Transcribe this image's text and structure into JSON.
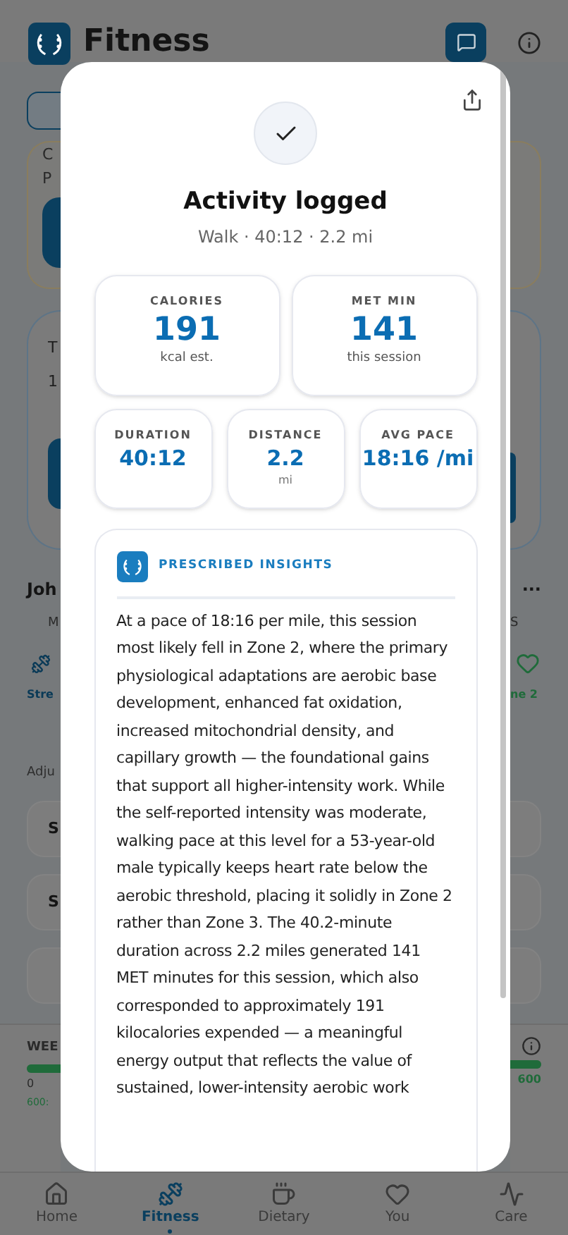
{
  "header": {
    "title": "Fitness"
  },
  "background": {
    "intro_lines": [
      "C",
      "P"
    ],
    "today_lines": [
      "T",
      "1"
    ],
    "member": {
      "name": "Joh",
      "more": "···"
    },
    "ring_headings": [
      "M",
      "S"
    ],
    "rings": [
      {
        "kind": "strength",
        "label": "Stre"
      },
      {
        "kind": "heart",
        "label": "ne 2"
      }
    ],
    "adjust_label": "Adju",
    "options": [
      "S",
      "S"
    ],
    "weekly": {
      "label": "WEE",
      "level": 1,
      "min": "0",
      "max": "600",
      "note": "600:"
    }
  },
  "modal": {
    "title": "Activity logged",
    "subtitle": "Walk · 40:12 · 2.2 mi",
    "stats_main": [
      {
        "label": "CALORIES",
        "value": "191",
        "unit": "kcal est."
      },
      {
        "label": "MET MIN",
        "value": "141",
        "unit": "this session"
      }
    ],
    "stats_small": [
      {
        "label": "DURATION",
        "value": "40:12"
      },
      {
        "label": "DISTANCE",
        "value": "2.2",
        "unit": "mi"
      },
      {
        "label": "AVG PACE",
        "value": "18:16 /mi"
      }
    ],
    "insights": {
      "title": "PRESCRIBED INSIGHTS",
      "body": "At a pace of 18:16 per mile, this session most likely fell in Zone 2, where the primary physiological adaptations are aerobic base development, enhanced fat oxidation, increased mitochondrial density, and capillary growth — the foundational gains that support all higher-intensity work. While the self-reported intensity was moderate, walking pace at this level for a 53-year-old male typically keeps heart rate below the aerobic threshold, placing it solidly in Zone 2 rather than Zone 3. The 40.2-minute duration across 2.2 miles generated 141 MET minutes for this session, which also corresponded to approximately 191 kilocalories expended — a meaningful energy output that reflects the value of sustained, lower-intensity aerobic work"
    }
  },
  "nav": [
    {
      "kind": "home",
      "label": "Home",
      "selected": false
    },
    {
      "kind": "fitness",
      "label": "Fitness",
      "selected": true
    },
    {
      "kind": "dietary",
      "label": "Dietary",
      "selected": false
    },
    {
      "kind": "you",
      "label": "You",
      "selected": false
    },
    {
      "kind": "care",
      "label": "Care",
      "selected": false
    }
  ]
}
